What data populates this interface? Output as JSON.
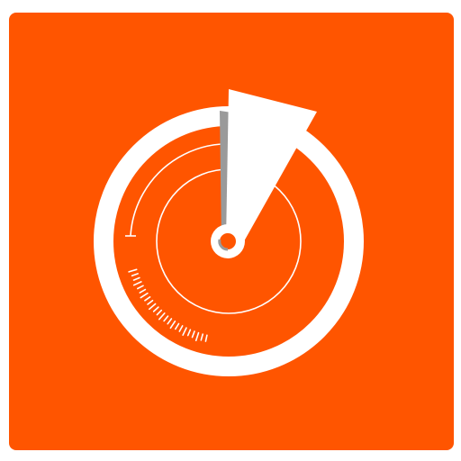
{
  "icon": {
    "name": "radar-timer-app-icon",
    "depicts": "radar-dial-icon",
    "colors": {
      "background": "#FF5500",
      "foreground": "#FFFFFF",
      "pointer_shadow": "#9A9A9A"
    }
  }
}
